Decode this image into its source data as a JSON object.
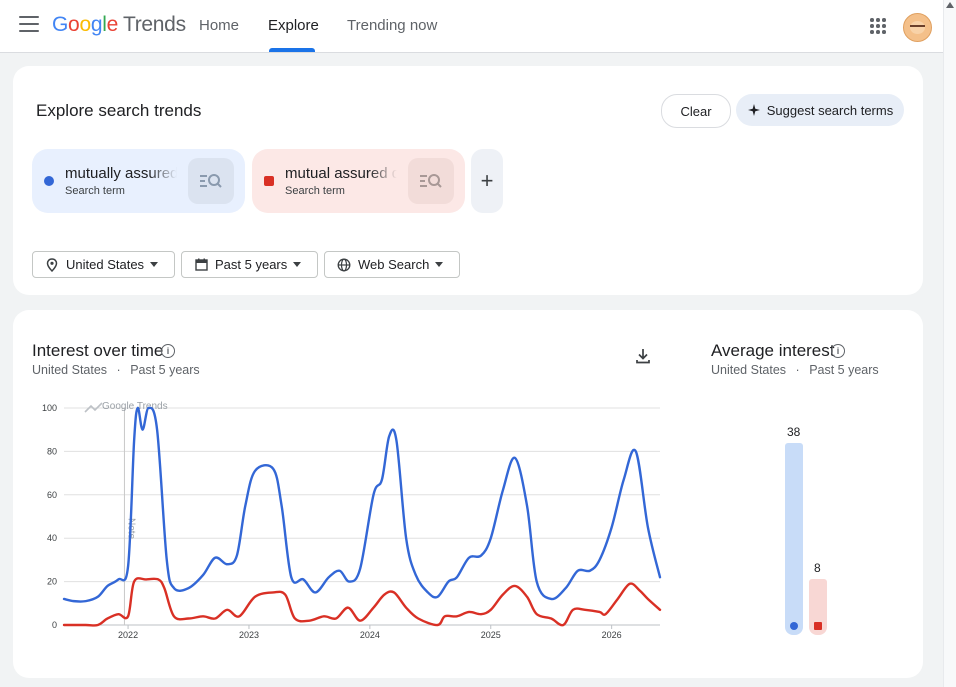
{
  "header": {
    "logo_google": "Google",
    "logo_product": "Trends",
    "nav": [
      "Home",
      "Explore",
      "Trending now"
    ]
  },
  "explore": {
    "title": "Explore search trends",
    "clear_label": "Clear",
    "suggest_label": "Suggest search terms",
    "terms": [
      {
        "name": "mutually assured destruction",
        "type": "Search term",
        "color": "#3367d6"
      },
      {
        "name": "mutual assured destruction",
        "type": "Search term",
        "color": "#d93025"
      }
    ],
    "filters": {
      "region": "United States",
      "time": "Past 5 years",
      "property": "Web Search"
    }
  },
  "interest": {
    "title": "Interest over time",
    "sub_region": "United States",
    "sub_sep": "·",
    "sub_time": "Past 5 years",
    "watermark": "Google Trends",
    "note_label": "Note"
  },
  "average": {
    "title": "Average interest",
    "sub_region": "United States",
    "sub_sep": "·",
    "sub_time": "Past 5 years",
    "values": [
      38,
      8
    ],
    "colors": [
      "#3367d6",
      "#d93025"
    ]
  },
  "chart_data": {
    "type": "line",
    "ylim": [
      0,
      100
    ],
    "yticks": [
      0,
      20,
      40,
      60,
      80,
      100
    ],
    "xticks": [
      "2022",
      "2023",
      "2024",
      "2025",
      "2026"
    ],
    "xrange_years": [
      2021.47,
      2026.4
    ],
    "series": [
      {
        "name": "mutually assured destruction",
        "color": "#3367d6",
        "points": [
          [
            2021.47,
            12
          ],
          [
            2021.55,
            11
          ],
          [
            2021.65,
            11
          ],
          [
            2021.75,
            13
          ],
          [
            2021.83,
            18
          ],
          [
            2021.92,
            21
          ],
          [
            2022.0,
            27
          ],
          [
            2022.05,
            85
          ],
          [
            2022.08,
            100
          ],
          [
            2022.12,
            90
          ],
          [
            2022.17,
            100
          ],
          [
            2022.24,
            90
          ],
          [
            2022.32,
            30
          ],
          [
            2022.38,
            17
          ],
          [
            2022.5,
            17
          ],
          [
            2022.62,
            23
          ],
          [
            2022.72,
            31
          ],
          [
            2022.82,
            28
          ],
          [
            2022.9,
            32
          ],
          [
            2022.97,
            55
          ],
          [
            2023.05,
            71
          ],
          [
            2023.2,
            72
          ],
          [
            2023.27,
            55
          ],
          [
            2023.35,
            22
          ],
          [
            2023.45,
            21
          ],
          [
            2023.55,
            15
          ],
          [
            2023.66,
            22
          ],
          [
            2023.75,
            25
          ],
          [
            2023.83,
            20
          ],
          [
            2023.92,
            26
          ],
          [
            2024.03,
            60
          ],
          [
            2024.1,
            67
          ],
          [
            2024.16,
            87
          ],
          [
            2024.22,
            85
          ],
          [
            2024.3,
            40
          ],
          [
            2024.38,
            23
          ],
          [
            2024.48,
            15
          ],
          [
            2024.56,
            13
          ],
          [
            2024.65,
            20
          ],
          [
            2024.72,
            22
          ],
          [
            2024.82,
            31
          ],
          [
            2024.92,
            32
          ],
          [
            2025.0,
            40
          ],
          [
            2025.1,
            62
          ],
          [
            2025.2,
            77
          ],
          [
            2025.3,
            55
          ],
          [
            2025.38,
            20
          ],
          [
            2025.5,
            12
          ],
          [
            2025.62,
            17
          ],
          [
            2025.72,
            25
          ],
          [
            2025.82,
            25
          ],
          [
            2025.9,
            30
          ],
          [
            2026.0,
            45
          ],
          [
            2026.1,
            67
          ],
          [
            2026.2,
            80
          ],
          [
            2026.3,
            45
          ],
          [
            2026.4,
            22
          ]
        ]
      },
      {
        "name": "mutual assured destruction",
        "color": "#d93025",
        "points": [
          [
            2021.47,
            0
          ],
          [
            2021.65,
            0
          ],
          [
            2021.75,
            0
          ],
          [
            2021.83,
            3
          ],
          [
            2021.92,
            5
          ],
          [
            2022.0,
            4
          ],
          [
            2022.05,
            20
          ],
          [
            2022.15,
            21
          ],
          [
            2022.25,
            21
          ],
          [
            2022.3,
            17
          ],
          [
            2022.38,
            4
          ],
          [
            2022.5,
            3
          ],
          [
            2022.62,
            4
          ],
          [
            2022.72,
            3
          ],
          [
            2022.82,
            7
          ],
          [
            2022.92,
            4
          ],
          [
            2023.05,
            13
          ],
          [
            2023.2,
            15
          ],
          [
            2023.3,
            14
          ],
          [
            2023.38,
            3
          ],
          [
            2023.5,
            2
          ],
          [
            2023.62,
            4
          ],
          [
            2023.72,
            3
          ],
          [
            2023.82,
            8
          ],
          [
            2023.92,
            2
          ],
          [
            2024.03,
            8
          ],
          [
            2024.12,
            14
          ],
          [
            2024.2,
            15
          ],
          [
            2024.3,
            8
          ],
          [
            2024.4,
            3
          ],
          [
            2024.56,
            0
          ],
          [
            2024.62,
            4
          ],
          [
            2024.72,
            4
          ],
          [
            2024.82,
            6
          ],
          [
            2024.92,
            5
          ],
          [
            2025.0,
            7
          ],
          [
            2025.1,
            14
          ],
          [
            2025.2,
            18
          ],
          [
            2025.3,
            13
          ],
          [
            2025.38,
            5
          ],
          [
            2025.5,
            3
          ],
          [
            2025.6,
            0
          ],
          [
            2025.68,
            7
          ],
          [
            2025.78,
            7
          ],
          [
            2025.9,
            6
          ],
          [
            2025.95,
            5
          ],
          [
            2026.05,
            12
          ],
          [
            2026.15,
            19
          ],
          [
            2026.23,
            16
          ],
          [
            2026.3,
            12
          ],
          [
            2026.4,
            7
          ]
        ]
      }
    ]
  }
}
